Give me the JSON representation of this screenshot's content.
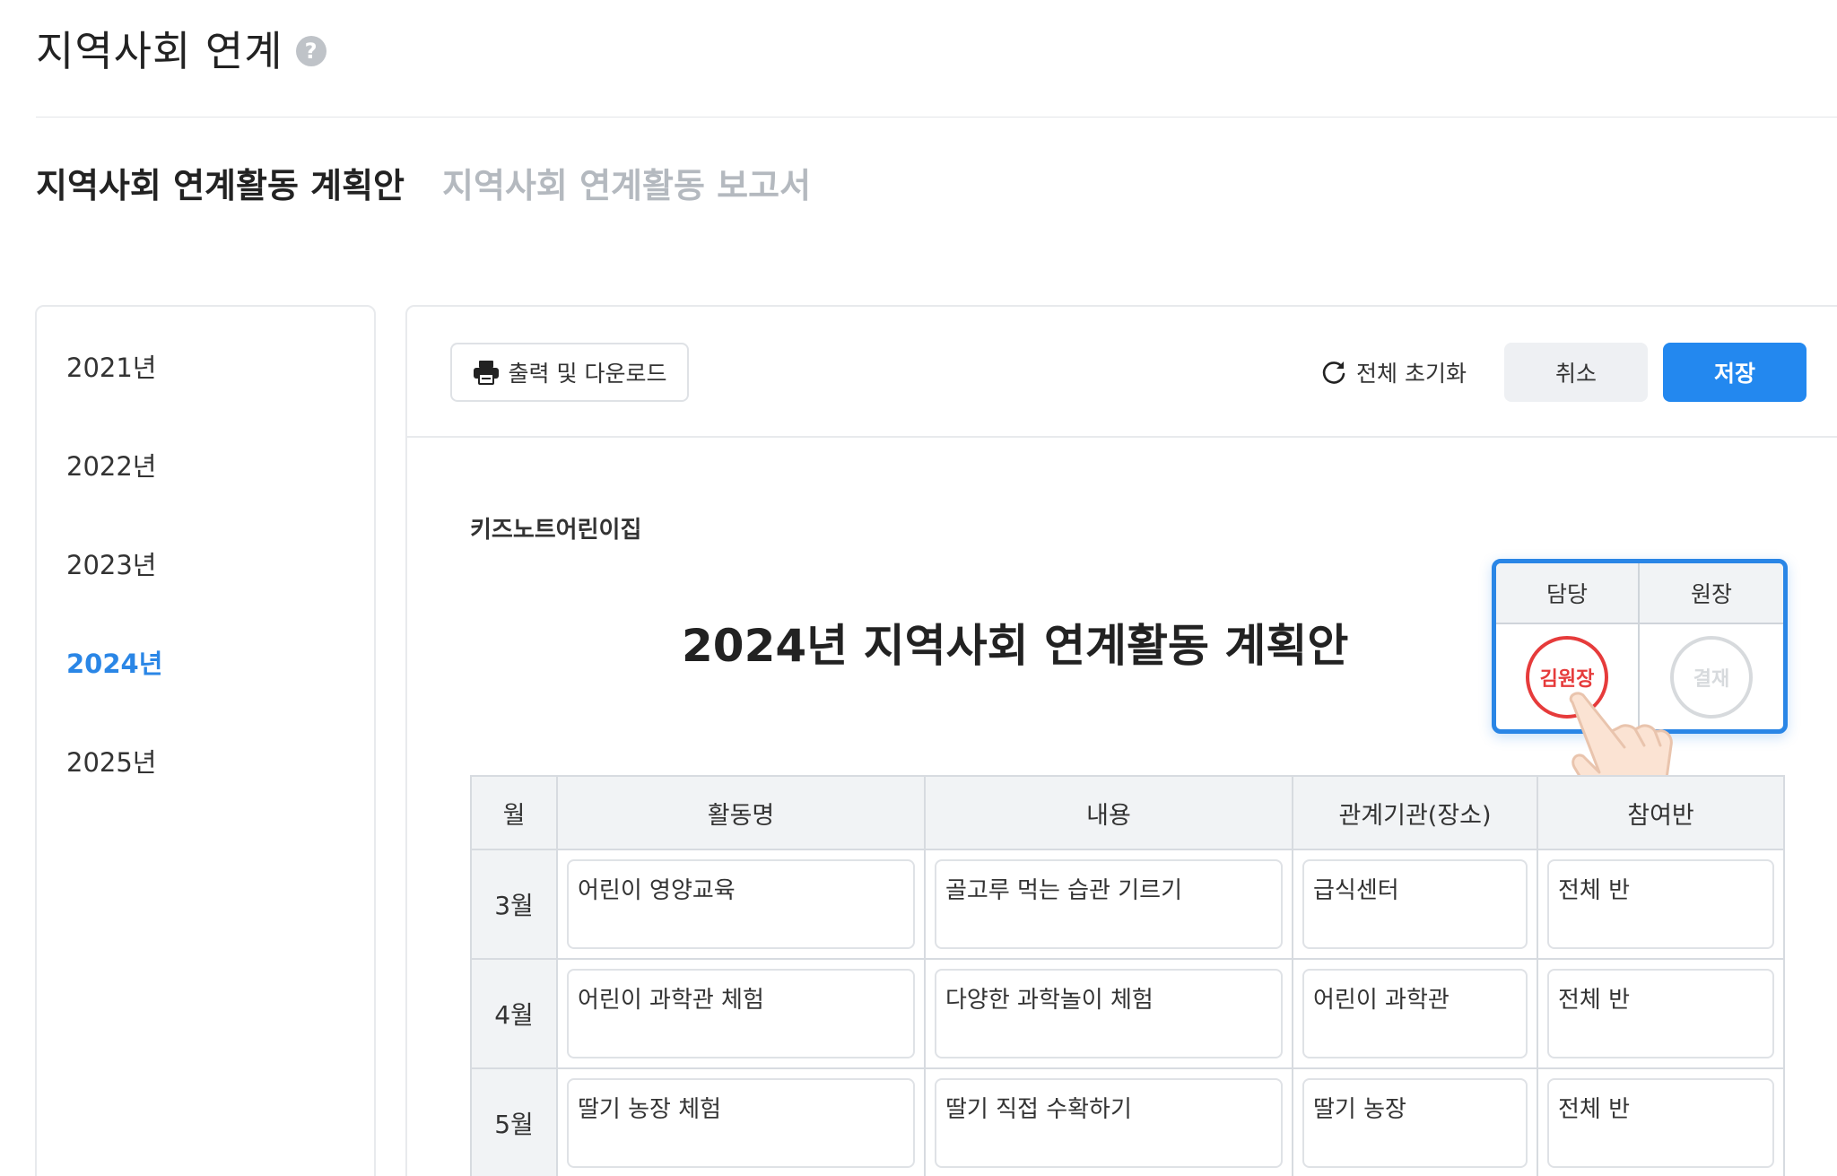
{
  "page": {
    "title": "지역사회 연계"
  },
  "tabs": [
    {
      "label": "지역사회 연계활동 계획안"
    },
    {
      "label": "지역사회 연계활동 보고서"
    }
  ],
  "years": [
    {
      "label": "2021년"
    },
    {
      "label": "2022년"
    },
    {
      "label": "2023년"
    },
    {
      "label": "2024년"
    },
    {
      "label": "2025년"
    }
  ],
  "toolbar": {
    "print_label": "출력 및 다운로드",
    "reset_label": "전체 초기화",
    "cancel_label": "취소",
    "save_label": "저장"
  },
  "document": {
    "org_name": "키즈노트어린이집",
    "title": "2024년 지역사회 연계활동 계획안"
  },
  "approval": {
    "headers": [
      "담당",
      "원장"
    ],
    "stamps": [
      "김원장",
      "결재"
    ]
  },
  "table": {
    "headers": [
      "월",
      "활동명",
      "내용",
      "관계기관(장소)",
      "참여반"
    ],
    "rows": [
      {
        "month": "3월",
        "activity": "어린이 영양교육",
        "content": "골고루 먹는 습관 기르기",
        "place": "급식센터",
        "class": "전체 반"
      },
      {
        "month": "4월",
        "activity": "어린이 과학관 체험",
        "content": "다양한 과학놀이 체험",
        "place": "어린이 과학관",
        "class": "전체 반"
      },
      {
        "month": "5월",
        "activity": "딸기 농장 체험",
        "content": "딸기 직접 수확하기",
        "place": "딸기 농장",
        "class": "전체 반"
      }
    ]
  },
  "colors": {
    "accent": "#2388ef",
    "stamp": "#e63b3b"
  }
}
